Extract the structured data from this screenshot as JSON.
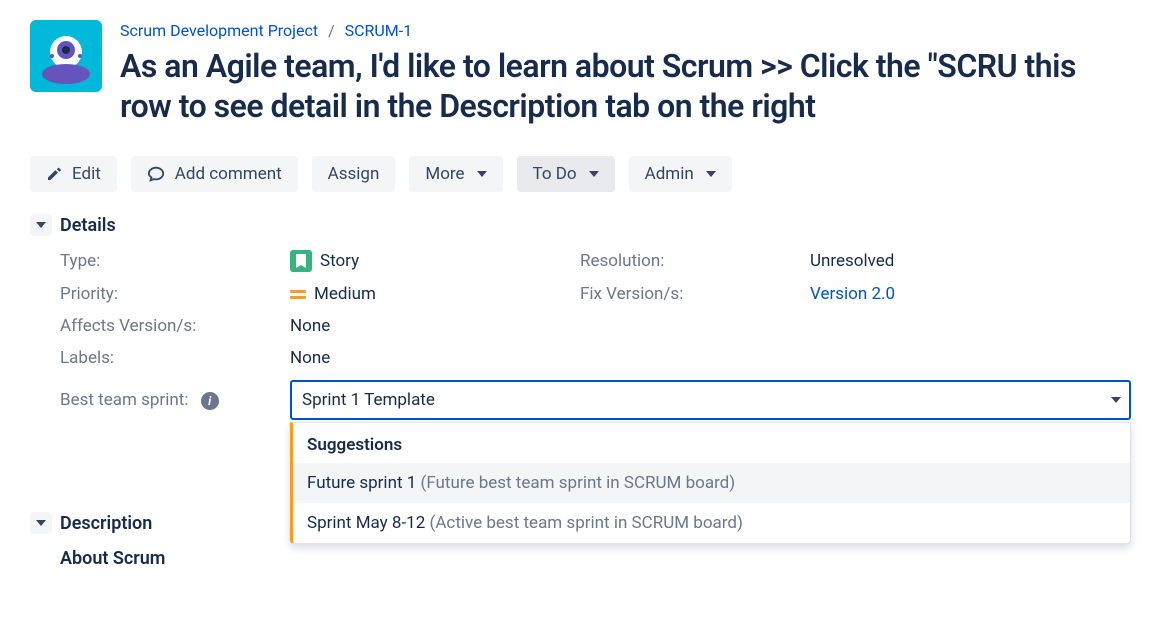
{
  "breadcrumb": {
    "project": "Scrum Development Project",
    "issue": "SCRUM-1"
  },
  "title": "As an Agile team, I'd like to learn about Scrum >> Click the \"SCRU this row to see detail in the Description tab on the right",
  "toolbar": {
    "edit": "Edit",
    "addComment": "Add comment",
    "assign": "Assign",
    "more": "More",
    "status": "To Do",
    "admin": "Admin"
  },
  "sections": {
    "details": "Details",
    "description": "Description"
  },
  "details": {
    "typeLabel": "Type:",
    "typeValue": "Story",
    "resolutionLabel": "Resolution:",
    "resolutionValue": "Unresolved",
    "priorityLabel": "Priority:",
    "priorityValue": "Medium",
    "fixVersionLabel": "Fix Version/s:",
    "fixVersionValue": "Version 2.0",
    "affectsLabel": "Affects Version/s:",
    "affectsValue": "None",
    "labelsLabel": "Labels:",
    "labelsValue": "None",
    "sprintLabel": "Best team sprint:",
    "sprintValue": "Sprint 1 Template"
  },
  "dropdown": {
    "header": "Suggestions",
    "items": [
      {
        "primary": "Future sprint 1 ",
        "secondary": "(Future best team sprint in SCRUM board)",
        "hovered": true
      },
      {
        "primary": "Sprint May 8-12 ",
        "secondary": "(Active best team sprint in SCRUM board)",
        "hovered": false
      }
    ]
  },
  "description": {
    "heading": "About Scrum"
  }
}
